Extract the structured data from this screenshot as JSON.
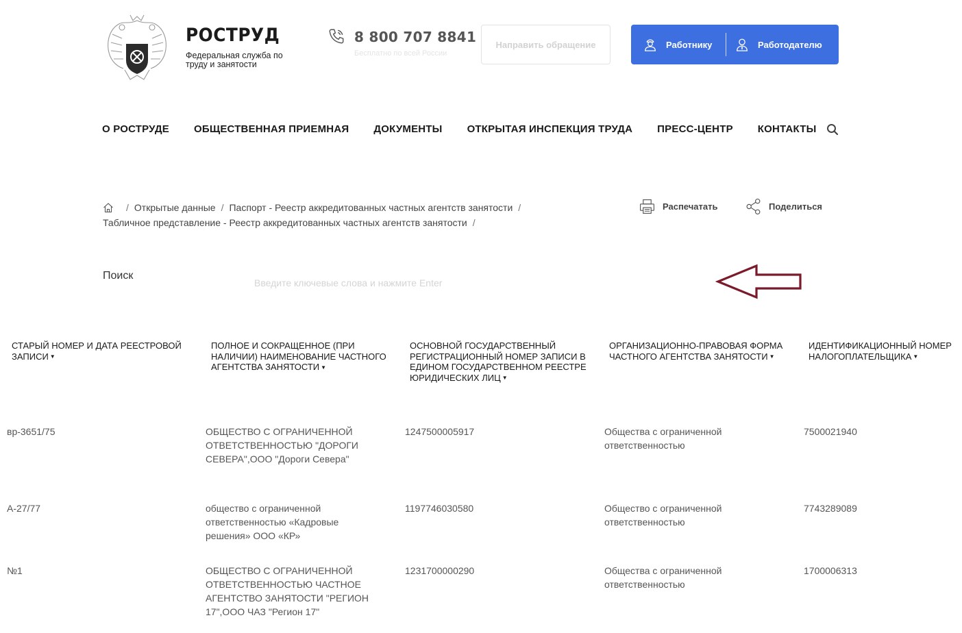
{
  "header": {
    "brand_title": "РОСТРУД",
    "brand_subtitle": "Федеральная служба по труду и занятости",
    "phone": "8 800 707 8841",
    "phone_note": "Бесплатно по всей России",
    "appeal_button": "Направить обращение",
    "worker_button": "Работнику",
    "employer_button": "Работодателю",
    "accent_color": "#3d6fe0"
  },
  "nav": {
    "items": [
      "О РОСТРУДЕ",
      "ОБЩЕСТВЕННАЯ ПРИЕМНАЯ",
      "ДОКУМЕНТЫ",
      "ОТКРЫТАЯ ИНСПЕКЦИЯ ТРУДА",
      "ПРЕСС-ЦЕНТР",
      "КОНТАКТЫ"
    ]
  },
  "breadcrumb": {
    "items": [
      "Открытые данные",
      "Паспорт - Реестр аккредитованных частных агентств занятости",
      "Табличное представление - Реестр аккредитованных частных агентств занятости"
    ]
  },
  "actions": {
    "print": "Распечатать",
    "share": "Поделиться"
  },
  "search": {
    "label": "Поиск",
    "placeholder": "Введите ключевые слова и нажмите Enter"
  },
  "table": {
    "headers": [
      "СТАРЫЙ НОМЕР И ДАТА РЕЕСТРОВОЙ ЗАПИСИ",
      "ПОЛНОЕ И СОКРАЩЕННОЕ (ПРИ НАЛИЧИИ) НАИМЕНОВАНИЕ ЧАСТНОГО АГЕНТСТВА ЗАНЯТОСТИ",
      "ОСНОВНОЙ ГОСУДАРСТВЕННЫЙ РЕГИСТРАЦИОННЫЙ НОМЕР ЗАПИСИ В ЕДИНОМ ГОСУДАРСТВЕННОМ РЕЕСТРЕ ЮРИДИЧЕСКИХ ЛИЦ",
      "ОРГАНИЗАЦИОННО-ПРАВОВАЯ ФОРМА ЧАСТНОГО АГЕНТСТВА ЗАНЯТОСТИ",
      "ИДЕНТИФИКАЦИОННЫЙ НОМЕР НАЛОГОПЛАТЕЛЬЩИКА"
    ],
    "rows": [
      [
        "вр-3651/75",
        "ОБЩЕСТВО С ОГРАНИЧЕННОЙ ОТВЕТСТВЕННОСТЬЮ \"ДОРОГИ СЕВЕРА\",ООО \"Дороги Севера\"",
        "1247500005917",
        "Общества с ограниченной ответственностью",
        "7500021940"
      ],
      [
        "А-27/77",
        "общество с ограниченной ответственностью «Кадровые решения» ООО «КР»",
        "1197746030580",
        "Общество с ограниченной ответственностью",
        "7743289089"
      ],
      [
        "№1",
        "ОБЩЕСТВО С ОГРАНИЧЕННОЙ ОТВЕТСТВЕННОСТЬЮ ЧАСТНОЕ АГЕНТСТВО ЗАНЯТОСТИ \"РЕГИОН 17\",ООО ЧАЗ \"Регион 17\"",
        "1231700000290",
        "Общества с ограниченной ответственностью",
        "1700006313"
      ]
    ]
  }
}
